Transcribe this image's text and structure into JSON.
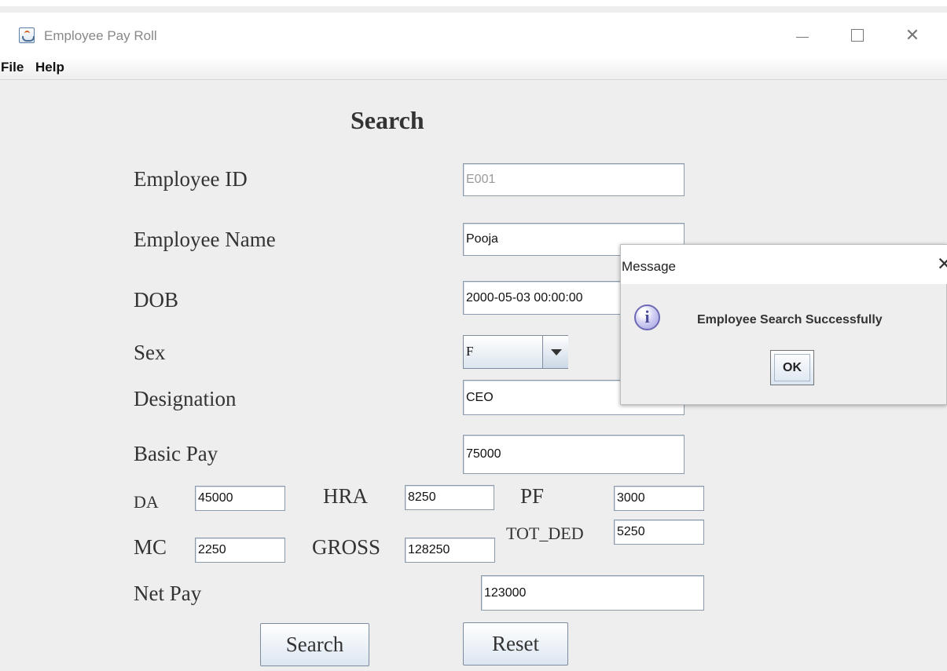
{
  "window": {
    "title": "Employee Pay Roll",
    "controls": {
      "minimize": "—",
      "maximize": "□",
      "close": "✕"
    }
  },
  "menu": {
    "items": [
      "File",
      "Help"
    ]
  },
  "form": {
    "title": "Search",
    "labels": {
      "employee_id": "Employee ID",
      "employee_name": "Employee Name",
      "dob": "DOB",
      "sex": "Sex",
      "designation": "Designation",
      "basic_pay": "Basic Pay",
      "da": "DA",
      "hra": "HRA",
      "pf": "PF",
      "mc": "MC",
      "gross": "GROSS",
      "tot_ded": "TOT_DED",
      "net_pay": "Net Pay"
    },
    "values": {
      "employee_id": "E001",
      "employee_name": "Pooja",
      "dob": "2000-05-03 00:00:00",
      "sex": "F",
      "designation": "CEO",
      "basic_pay": "75000",
      "da": "45000",
      "hra": "8250",
      "pf": "3000",
      "mc": "2250",
      "gross": "128250",
      "tot_ded": "5250",
      "net_pay": "123000"
    },
    "buttons": {
      "search": "Search",
      "reset": "Reset"
    }
  },
  "dialog": {
    "title": "Message",
    "close": "✕",
    "icon": "info-icon",
    "icon_text": "i",
    "message": "Employee Search Successfully",
    "ok": "OK"
  }
}
